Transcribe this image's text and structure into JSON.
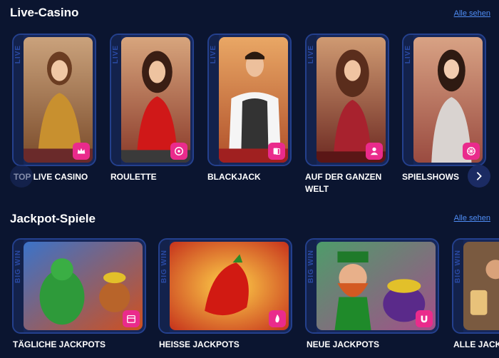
{
  "live_casino": {
    "title": "Live-Casino",
    "see_all": "Alle sehen",
    "strip_text": "LIVE",
    "games": [
      {
        "label": "TOP LIVE CASINO",
        "icon": "crown-icon"
      },
      {
        "label": "ROULETTE",
        "icon": "roulette-wheel-icon"
      },
      {
        "label": "BLACKJACK",
        "icon": "cards-icon"
      },
      {
        "label": "AUF DER GANZEN WELT",
        "icon": "dealer-icon"
      },
      {
        "label": "SPIELSHOWS",
        "icon": "wheel-icon"
      }
    ]
  },
  "jackpot": {
    "title": "Jackpot-Spiele",
    "see_all": "Alle sehen",
    "strip_text": "BIG WIN",
    "games": [
      {
        "label": "TÄGLICHE JACKPOTS",
        "icon": "calendar-icon"
      },
      {
        "label": "HEISSE JACKPOTS",
        "icon": "flame-icon"
      },
      {
        "label": "NEUE JACKPOTS",
        "icon": "magnet-icon"
      },
      {
        "label": "ALLE JACKPOTS",
        "icon": "star-icon"
      }
    ]
  },
  "colors": {
    "background": "#0b1530",
    "accent": "#ea2b8c",
    "link": "#4f8df5",
    "card_border": "#24408d"
  }
}
